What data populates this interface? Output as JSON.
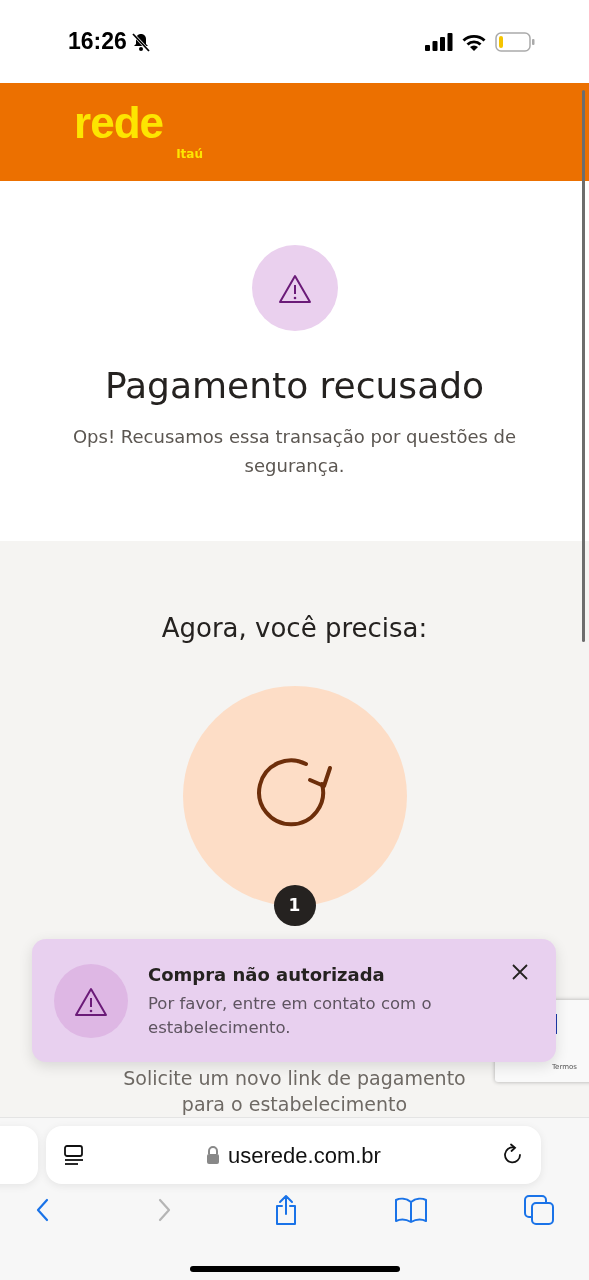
{
  "status_bar": {
    "time": "16:26",
    "silent": true
  },
  "header": {
    "logo": "rede",
    "logo_sub": "Itaú"
  },
  "result": {
    "title": "Pagamento recusado",
    "message": "Ops! Recusamos essa transação por questões de segurança."
  },
  "next_steps": {
    "heading": "Agora, você precisa:",
    "step_number": "1",
    "step_text": "Solicite um novo link de pagamento para o estabelecimento"
  },
  "toast": {
    "title": "Compra não autorizada",
    "message": "Por favor, entre em contato com o estabelecimento."
  },
  "recaptcha": {
    "link": "Termos"
  },
  "browser": {
    "url": "userede.com.br",
    "back_disabled": false,
    "forward_disabled": true
  }
}
